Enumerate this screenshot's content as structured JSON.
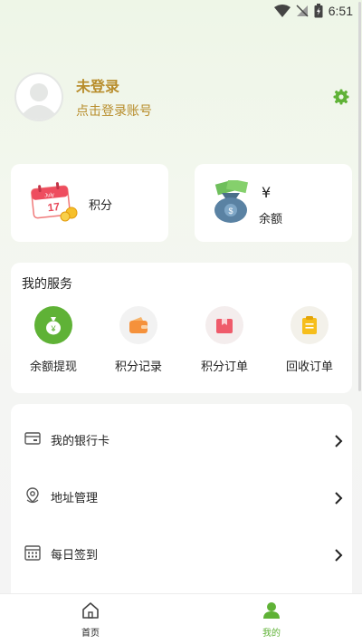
{
  "status_bar": {
    "time": "6:51"
  },
  "profile": {
    "name": "未登录",
    "subtitle": "点击登录账号"
  },
  "cards": {
    "points": {
      "label": "积分",
      "calendar_month": "July",
      "calendar_day": "17"
    },
    "balance": {
      "symbol": "¥",
      "label": "余额"
    }
  },
  "services": {
    "title": "我的服务",
    "items": [
      {
        "label": "余额提现",
        "icon": "money-bag-icon"
      },
      {
        "label": "积分记录",
        "icon": "wallet-icon"
      },
      {
        "label": "积分订单",
        "icon": "gift-box-icon"
      },
      {
        "label": "回收订单",
        "icon": "clipboard-icon"
      }
    ]
  },
  "menu": {
    "items": [
      {
        "label": "我的银行卡",
        "icon": "bank-card-icon"
      },
      {
        "label": "地址管理",
        "icon": "location-pin-icon"
      },
      {
        "label": "每日签到",
        "icon": "calendar-icon"
      }
    ]
  },
  "tabbar": {
    "home": "首页",
    "mine": "我的"
  },
  "colors": {
    "accent_green": "#5fb236",
    "gold_text": "#b88d2c"
  }
}
